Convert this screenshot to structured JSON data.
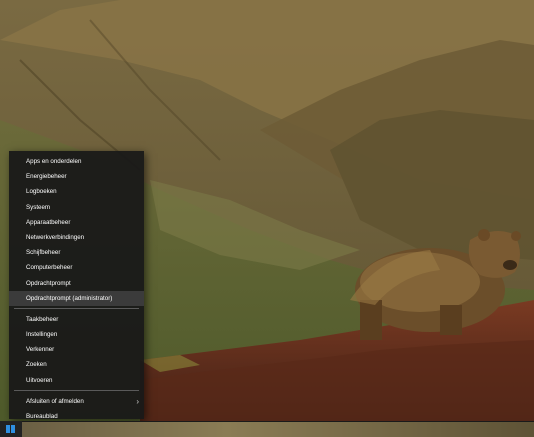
{
  "context_menu": {
    "items_group1": [
      {
        "label": "Apps en onderdelen"
      },
      {
        "label": "Energiebeheer"
      },
      {
        "label": "Logboeken"
      },
      {
        "label": "Systeem"
      },
      {
        "label": "Apparaatbeheer"
      },
      {
        "label": "Netwerkverbindingen"
      },
      {
        "label": "Schijfbeheer"
      },
      {
        "label": "Computerbeheer"
      },
      {
        "label": "Opdrachtprompt"
      },
      {
        "label": "Opdrachtprompt (administrator)"
      }
    ],
    "items_group2": [
      {
        "label": "Taakbeheer"
      },
      {
        "label": "Instellingen"
      },
      {
        "label": "Verkenner"
      },
      {
        "label": "Zoeken"
      },
      {
        "label": "Uitvoeren"
      }
    ],
    "items_group3": [
      {
        "label": "Afsluiten of afmelden",
        "submenu_arrow": "›"
      },
      {
        "label": "Bureaublad"
      }
    ]
  },
  "taskbar": {
    "start_icon": "windows-logo-icon"
  },
  "colors": {
    "menu_bg": "#181818",
    "menu_highlight": "#3b3b3b",
    "text": "#ffffff",
    "windows_blue": "#2f8fe0"
  }
}
